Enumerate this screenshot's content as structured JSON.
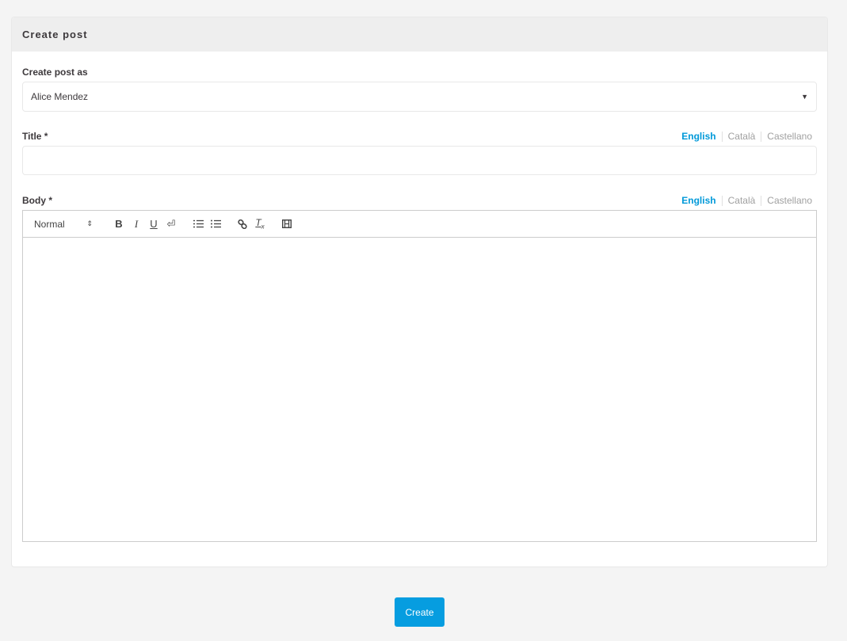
{
  "card": {
    "title": "Create post"
  },
  "author_field": {
    "label": "Create post as",
    "value": "Alice Mendez"
  },
  "title_field": {
    "label": "Title *",
    "value": "",
    "languages": [
      {
        "label": "English",
        "active": true
      },
      {
        "label": "Català",
        "active": false
      },
      {
        "label": "Castellano",
        "active": false
      }
    ]
  },
  "body_field": {
    "label": "Body *",
    "languages": [
      {
        "label": "English",
        "active": true
      },
      {
        "label": "Català",
        "active": false
      },
      {
        "label": "Castellano",
        "active": false
      }
    ],
    "toolbar": {
      "format_select": "Normal",
      "buttons": {
        "bold": "B",
        "italic": "I",
        "underline": "U",
        "linebreak": "⏎",
        "ordered_list": "≔",
        "bullet_list": "☰",
        "link": "🔗",
        "clean": "Tx",
        "video": "▣"
      }
    }
  },
  "actions": {
    "create_label": "Create"
  },
  "colors": {
    "accent": "#0099d9",
    "button": "#069de0",
    "background": "#f4f4f4"
  }
}
